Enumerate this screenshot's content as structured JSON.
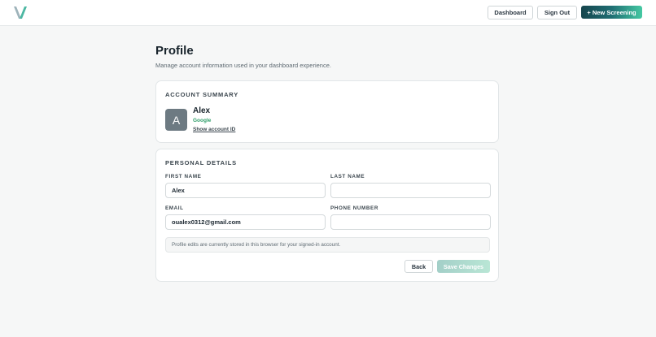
{
  "header": {
    "logo_icon": "v-logo-icon",
    "dashboard_label": "Dashboard",
    "signout_label": "Sign Out",
    "new_screening_label": "+ New Screening",
    "accent_color": "#1f6e73"
  },
  "page": {
    "title": "Profile",
    "subtitle": "Manage account information used in your dashboard experience."
  },
  "account_summary": {
    "heading": "ACCOUNT SUMMARY",
    "avatar_initial": "A",
    "name": "Alex",
    "provider": "Google",
    "show_account_id_label": "Show account ID"
  },
  "personal_details": {
    "heading": "PERSONAL DETAILS",
    "first_name": {
      "label": "FIRST NAME",
      "value": "Alex"
    },
    "last_name": {
      "label": "LAST NAME",
      "value": ""
    },
    "email": {
      "label": "EMAIL",
      "value": "oualex0312@gmail.com"
    },
    "phone": {
      "label": "PHONE NUMBER",
      "value": ""
    },
    "notice": "Profile edits are currently stored in this browser for your signed-in account.",
    "back_label": "Back",
    "save_label": "Save Changes"
  }
}
